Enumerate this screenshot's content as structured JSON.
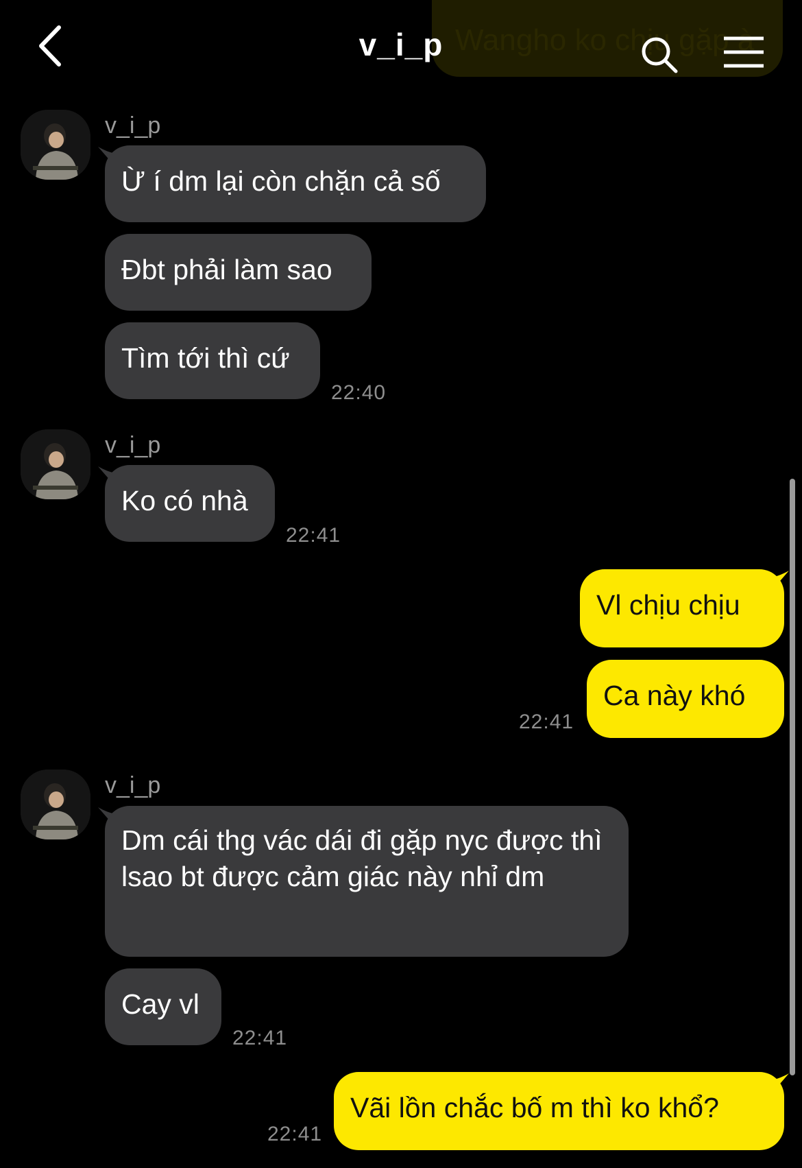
{
  "header": {
    "title": "v_i_p",
    "back_icon": "chevron-left-icon",
    "search_icon": "search-icon",
    "menu_icon": "hamburger-menu-icon",
    "ghost_notice": "Wangho ko chịu gặp à"
  },
  "colors": {
    "background": "#000000",
    "incoming_bubble": "#3a3a3c",
    "outgoing_bubble": "#fde800",
    "timestamp": "#8e8e8e"
  },
  "groups": [
    {
      "sender": "v_i_p",
      "messages": [
        "Ừ í dm lại còn chặn cả số",
        "Đbt phải làm sao",
        "Tìm tới thì cứ"
      ],
      "time": "22:40"
    },
    {
      "sender": "v_i_p",
      "messages": [
        "Ko có nhà"
      ],
      "time": "22:41"
    },
    {
      "outgoing": true,
      "messages": [
        "Vl chịu chịu",
        "Ca này khó"
      ],
      "time": "22:41"
    },
    {
      "sender": "v_i_p",
      "messages": [
        "Dm cái thg vác dái đi gặp nyc được thì lsao bt được cảm giác này nhỉ dm",
        "Cay vl"
      ],
      "time": "22:41"
    },
    {
      "outgoing": true,
      "messages": [
        "Vãi lồn chắc bố m thì ko khổ?"
      ],
      "time": "22:41"
    }
  ]
}
